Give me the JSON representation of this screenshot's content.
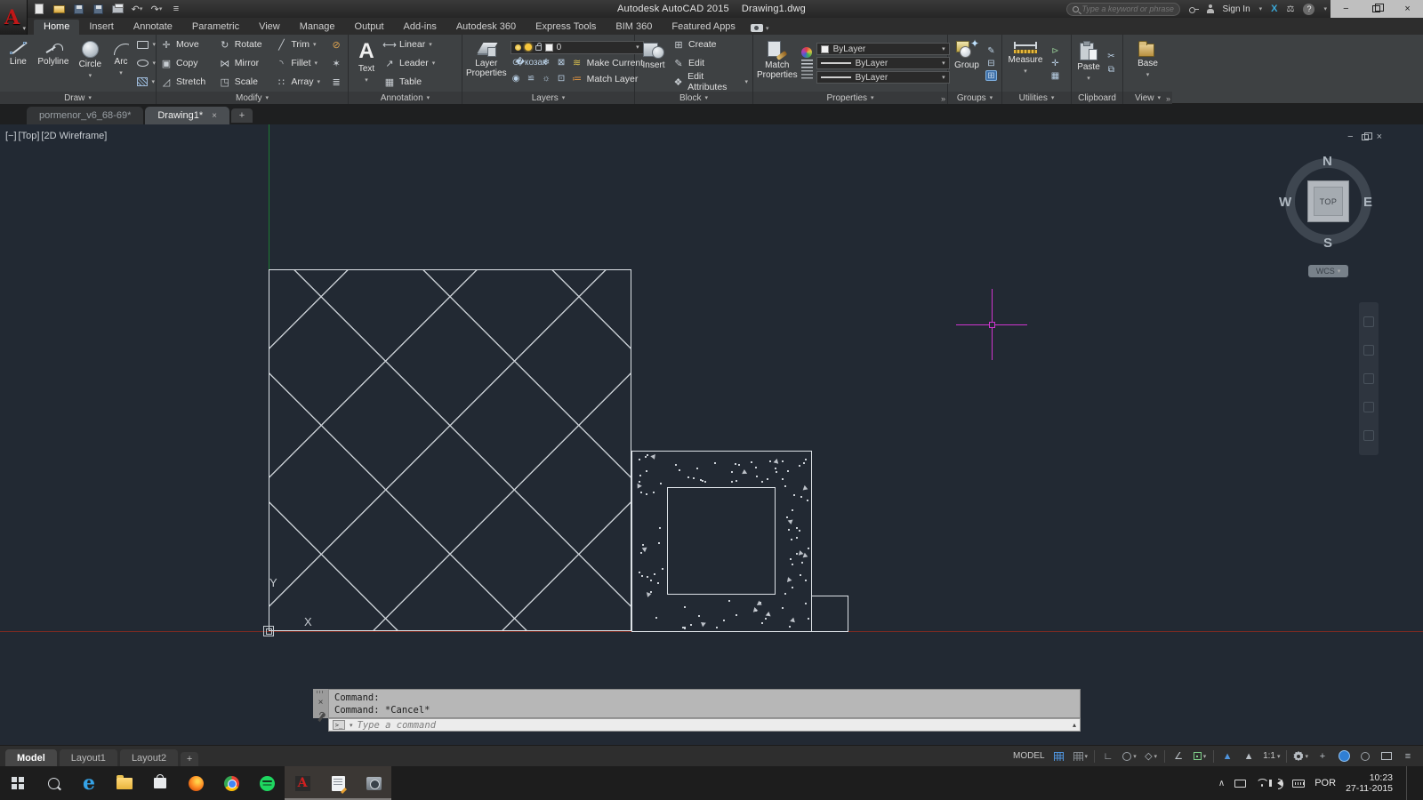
{
  "icons": {
    "caret_down": "▾",
    "caret_up": "▴",
    "close_x": "×",
    "minimize": "−",
    "plus": "+",
    "prompt_chip": ">_",
    "undo": "↶",
    "redo": "↷",
    "qat_menu": "≡",
    "chevron_up": "∧",
    "move": "✛",
    "rotate": "↻",
    "trim": "╱",
    "copy": "▣",
    "mirror": "⋈",
    "fillet": "◝",
    "stretch": "◿",
    "scale": "◳",
    "array": "∷",
    "erase": "⊘",
    "explode": "✶",
    "offset": "≣",
    "linear": "⟷",
    "leader": "↗",
    "table": "▦",
    "create_block": "⊞",
    "edit_block": "✎",
    "edit_attrs": "❖",
    "launcher": "»",
    "help": "?",
    "exchange": "X",
    "scales": "⚖",
    "ortho": "∟",
    "otrack": "∠",
    "iso": "◇",
    "anno_tri": "▲"
  },
  "title_bar": {
    "app_title": "Autodesk AutoCAD 2015",
    "doc_title": "Drawing1.dwg",
    "search_placeholder": "Type a keyword or phrase",
    "sign_in": "Sign In"
  },
  "ribbon_tabs": [
    "Home",
    "Insert",
    "Annotate",
    "Parametric",
    "View",
    "Manage",
    "Output",
    "Add-ins",
    "Autodesk 360",
    "Express Tools",
    "BIM 360",
    "Featured Apps"
  ],
  "ribbon": {
    "draw": {
      "label": "Draw",
      "b1": "Line",
      "b2": "Polyline",
      "b3": "Circle",
      "b4": "Arc"
    },
    "modify": {
      "label": "Modify",
      "i1": "Move",
      "i2": "Rotate",
      "i3": "Trim",
      "i4": "Copy",
      "i5": "Mirror",
      "i6": "Fillet",
      "i7": "Stretch",
      "i8": "Scale",
      "i9": "Array"
    },
    "annotation": {
      "label": "Annotation",
      "big": "Text",
      "i1": "Linear",
      "i2": "Leader",
      "i3": "Table"
    },
    "layers": {
      "label": "Layers",
      "big": "Layer Properties",
      "current_layer": "0",
      "i1": "Make Current",
      "i2": "Match Layer"
    },
    "block": {
      "label": "Block",
      "big": "Insert",
      "i1": "Create",
      "i2": "Edit",
      "i3": "Edit Attributes"
    },
    "properties": {
      "label": "Properties",
      "big": "Match Properties",
      "combo1": "ByLayer",
      "combo2": "ByLayer",
      "combo3": "ByLayer"
    },
    "groups": {
      "label": "Groups",
      "big": "Group"
    },
    "utilities": {
      "label": "Utilities",
      "big": "Measure"
    },
    "clipboard": {
      "label": "Clipboard",
      "big": "Paste"
    },
    "view": {
      "label": "View",
      "big": "Base"
    }
  },
  "file_tabs": {
    "tab1": "pormenor_v6_68-69*",
    "tab2": "Drawing1*"
  },
  "canvas": {
    "viewport_controls": {
      "minus": "[−]",
      "view": "[Top]",
      "visual_style": "[2D Wireframe]"
    },
    "viewcube": {
      "n": "N",
      "e": "E",
      "s": "S",
      "w": "W",
      "face": "TOP",
      "wcs": "WCS"
    },
    "ucs": {
      "x": "X",
      "y": "Y"
    },
    "colors": {
      "background": "#222933",
      "crosshair": "#cf36cf",
      "geometry": "#dde2e7",
      "axis_red": "#7c2a22",
      "axis_green": "#1d7a33"
    },
    "concrete_hatch": {
      "dots": 90,
      "triangles": 16,
      "seed": 11,
      "outer": [
        714,
        371,
        195,
        196
      ],
      "inner": [
        744,
        402,
        134,
        133
      ]
    }
  },
  "command_line": {
    "history_line1": "Command:",
    "history_line2": "Command: *Cancel*",
    "prompt_placeholder": "Type a command"
  },
  "status_bar": {
    "model_tab": "Model",
    "layout1_tab": "Layout1",
    "layout2_tab": "Layout2",
    "model_badge": "MODEL",
    "annotation_scale": "1:1"
  },
  "taskbar": {
    "language": "POR",
    "time": "10:23",
    "date": "27-11-2015"
  }
}
